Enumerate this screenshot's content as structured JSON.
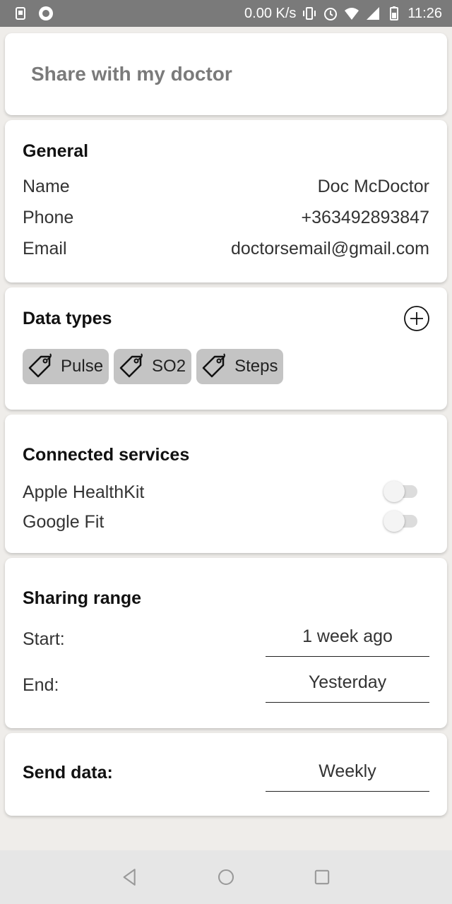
{
  "status_bar": {
    "network_speed": "0.00 K/s",
    "time": "11:26",
    "icons": [
      "notification-icon",
      "record-icon",
      "vibrate-icon",
      "alarm-icon",
      "wifi-icon",
      "signal-icon",
      "battery-icon"
    ]
  },
  "header": {
    "title": "Share with my doctor"
  },
  "general": {
    "title": "General",
    "rows": [
      {
        "label": "Name",
        "value": "Doc McDoctor"
      },
      {
        "label": "Phone",
        "value": "+363492893847"
      },
      {
        "label": "Email",
        "value": "doctorsemail@gmail.com"
      }
    ]
  },
  "data_types": {
    "title": "Data types",
    "add_icon": "add-circle-icon",
    "chips": [
      {
        "label": "Pulse",
        "icon": "tag-icon"
      },
      {
        "label": "SO2",
        "icon": "tag-icon"
      },
      {
        "label": "Steps",
        "icon": "tag-icon"
      }
    ]
  },
  "services": {
    "title": "Connected services",
    "items": [
      {
        "label": "Apple HealthKit",
        "enabled": false
      },
      {
        "label": "Google Fit",
        "enabled": false
      }
    ]
  },
  "range": {
    "title": "Sharing range",
    "start_label": "Start:",
    "start_value": "1 week ago",
    "end_label": "End:",
    "end_value": "Yesterday"
  },
  "send": {
    "label": "Send data:",
    "value": "Weekly"
  },
  "nav": {
    "icons": [
      "back-icon",
      "home-icon",
      "recents-icon"
    ]
  },
  "colors": {
    "chip_bg": "#c4c4c4",
    "header_title": "#7a7a7a",
    "status_bar": "#7a7a7a"
  }
}
